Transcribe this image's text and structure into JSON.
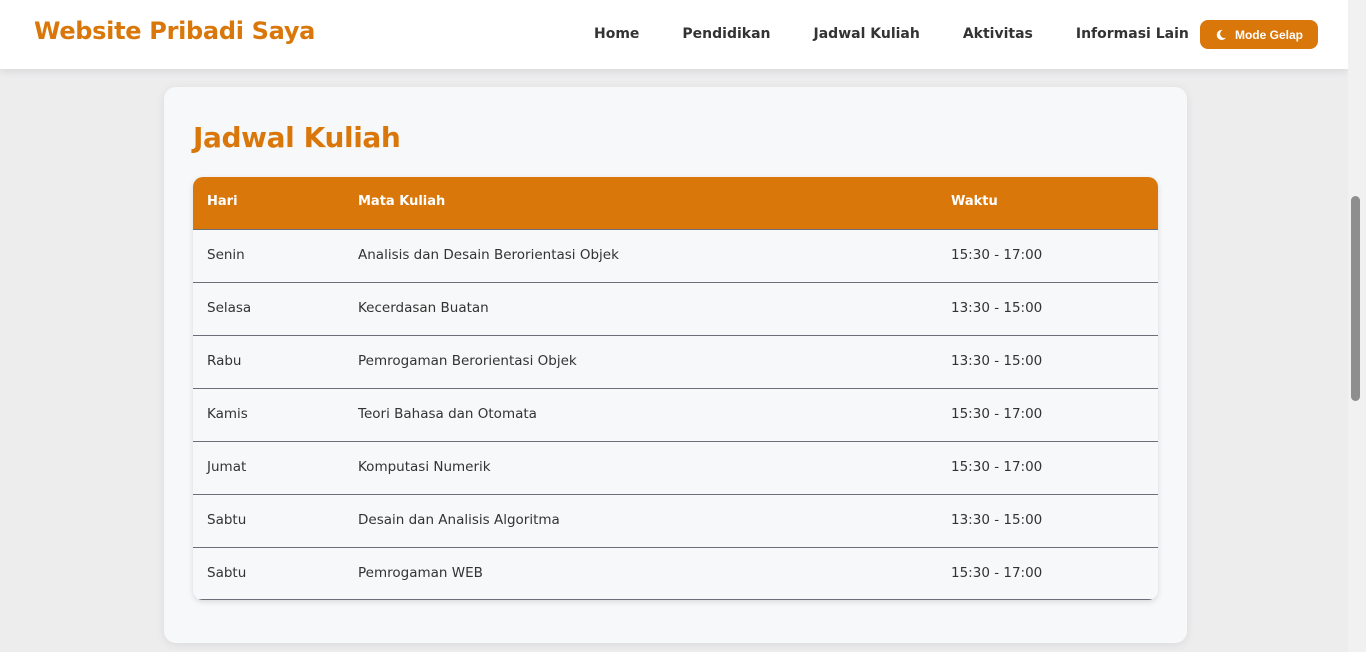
{
  "navbar": {
    "brand": "Website Pribadi Saya",
    "links": [
      "Home",
      "Pendidikan",
      "Jadwal Kuliah",
      "Aktivitas",
      "Informasi Lain"
    ],
    "mode_button": {
      "label": "Mode Gelap",
      "icon": "moon-icon"
    }
  },
  "schedule": {
    "title": "Jadwal Kuliah",
    "headers": [
      "Hari",
      "Mata Kuliah",
      "Waktu"
    ],
    "rows": [
      [
        "Senin",
        "Analisis dan Desain Berorientasi Objek",
        "15:30 - 17:00"
      ],
      [
        "Selasa",
        "Kecerdasan Buatan",
        "13:30 - 15:00"
      ],
      [
        "Rabu",
        "Pemrogaman Berorientasi Objek",
        "13:30 - 15:00"
      ],
      [
        "Kamis",
        "Teori Bahasa dan Otomata",
        "15:30 - 17:00"
      ],
      [
        "Jumat",
        "Komputasi Numerik",
        "15:30 - 17:00"
      ],
      [
        "Sabtu",
        "Desain dan Analisis Algoritma",
        "13:30 - 15:00"
      ],
      [
        "Sabtu",
        "Pemrogaman WEB",
        "15:30 - 17:00"
      ]
    ]
  },
  "colors": {
    "accent": "#d9770a",
    "card_background": "#f7f8f9",
    "page_background": "#ededee"
  }
}
